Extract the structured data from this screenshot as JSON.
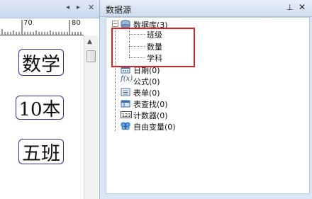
{
  "left_panel": {
    "ruler": {
      "labels": [
        "70",
        "80"
      ]
    },
    "fields": [
      "数学",
      "10本",
      "五班"
    ]
  },
  "datasource": {
    "title": "数据源",
    "tree": {
      "database": {
        "label": "数据库(3)",
        "children": [
          "班级",
          "数量",
          "学科"
        ]
      },
      "items": [
        {
          "label": "日期(0)",
          "icon": "calendar-icon"
        },
        {
          "label": "公式(0)",
          "icon": "formula-icon"
        },
        {
          "label": "表单(0)",
          "icon": "form-icon"
        },
        {
          "label": "表查找(0)",
          "icon": "table-lookup-icon"
        },
        {
          "label": "计数器(0)",
          "icon": "counter-icon"
        },
        {
          "label": "自由变量(0)",
          "icon": "butterfly-icon"
        }
      ]
    }
  },
  "colors": {
    "highlight": "#e02020",
    "panel_bg": "#dbe6f4"
  }
}
